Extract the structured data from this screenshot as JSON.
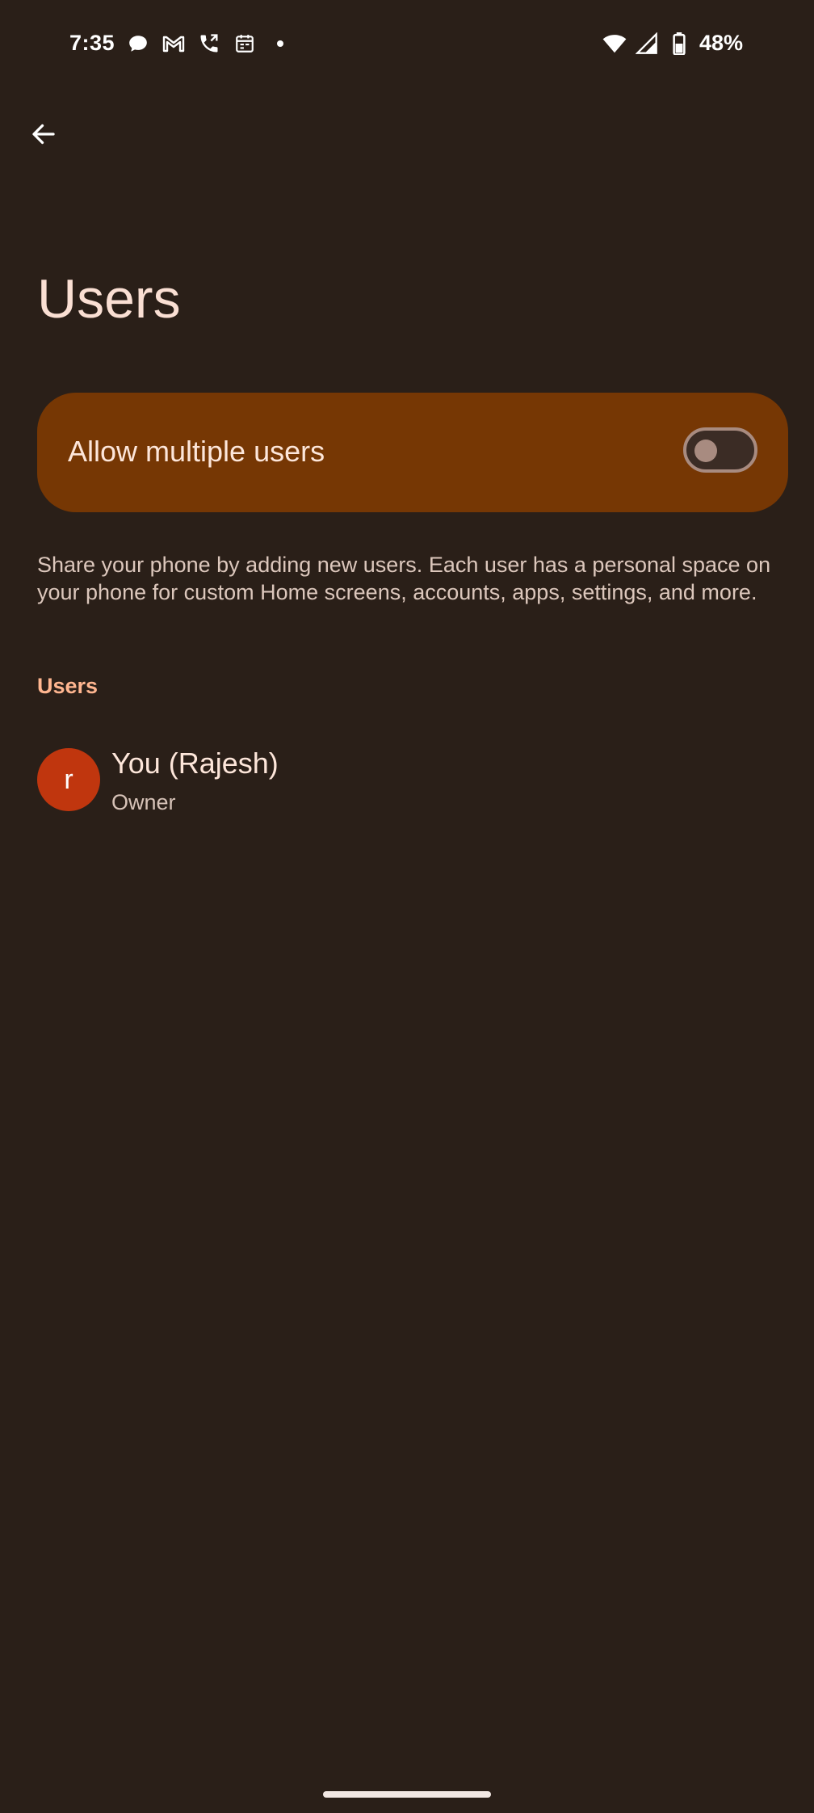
{
  "status_bar": {
    "time": "7:35",
    "battery": "48%",
    "icons_left": [
      "chat-icon",
      "gmail-icon",
      "call-forward-icon",
      "calendar-icon",
      "dot-icon"
    ],
    "icons_right": [
      "wifi-icon",
      "signal-icon",
      "battery-icon"
    ]
  },
  "header": {
    "title": "Users"
  },
  "toggle": {
    "label": "Allow multiple users",
    "checked": false
  },
  "description": "Share your phone by adding new users. Each user has a personal space on your phone for custom Home screens, accounts, apps, settings, and more.",
  "section": {
    "title": "Users"
  },
  "users": [
    {
      "initial": "r",
      "name": "You (Rajesh)",
      "role": "Owner"
    }
  ],
  "colors": {
    "background": "#2a1f18",
    "card": "#763704",
    "accent": "#ffb690",
    "avatar": "#c0360e"
  }
}
